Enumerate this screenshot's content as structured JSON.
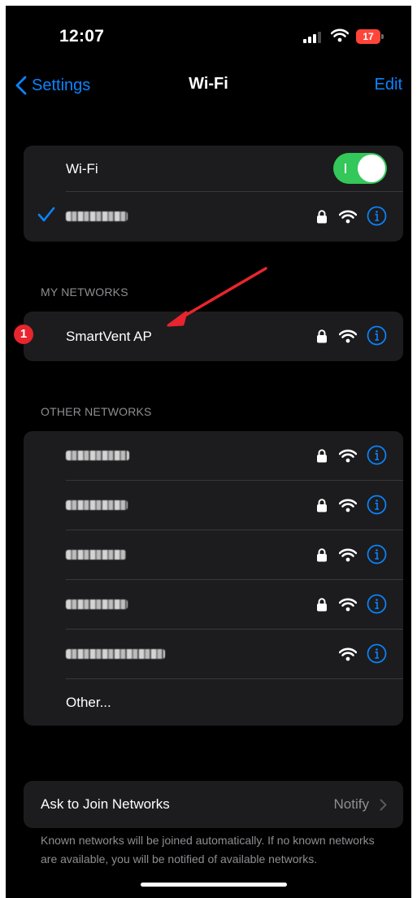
{
  "status_bar": {
    "time": "12:07",
    "battery": "17"
  },
  "nav": {
    "back_label": "Settings",
    "title": "Wi-Fi",
    "edit_label": "Edit"
  },
  "wifi_group": {
    "toggle_label": "Wi-Fi",
    "toggle_on": true
  },
  "sections": {
    "my_networks": "MY NETWORKS",
    "other_networks": "OTHER NETWORKS"
  },
  "my_networks": [
    {
      "name": "SmartVent AP",
      "badge": "1",
      "locked": true
    }
  ],
  "other_networks_other_label": "Other...",
  "ask_to_join": {
    "label": "Ask to Join Networks",
    "value": "Notify"
  },
  "footer": "Known networks will be joined automatically. If no known networks are available, you will be notified of available networks.",
  "colors": {
    "accent": "#0a84ff",
    "toggle": "#34c759",
    "badge": "#e8252e",
    "arrow": "#e8252e"
  }
}
